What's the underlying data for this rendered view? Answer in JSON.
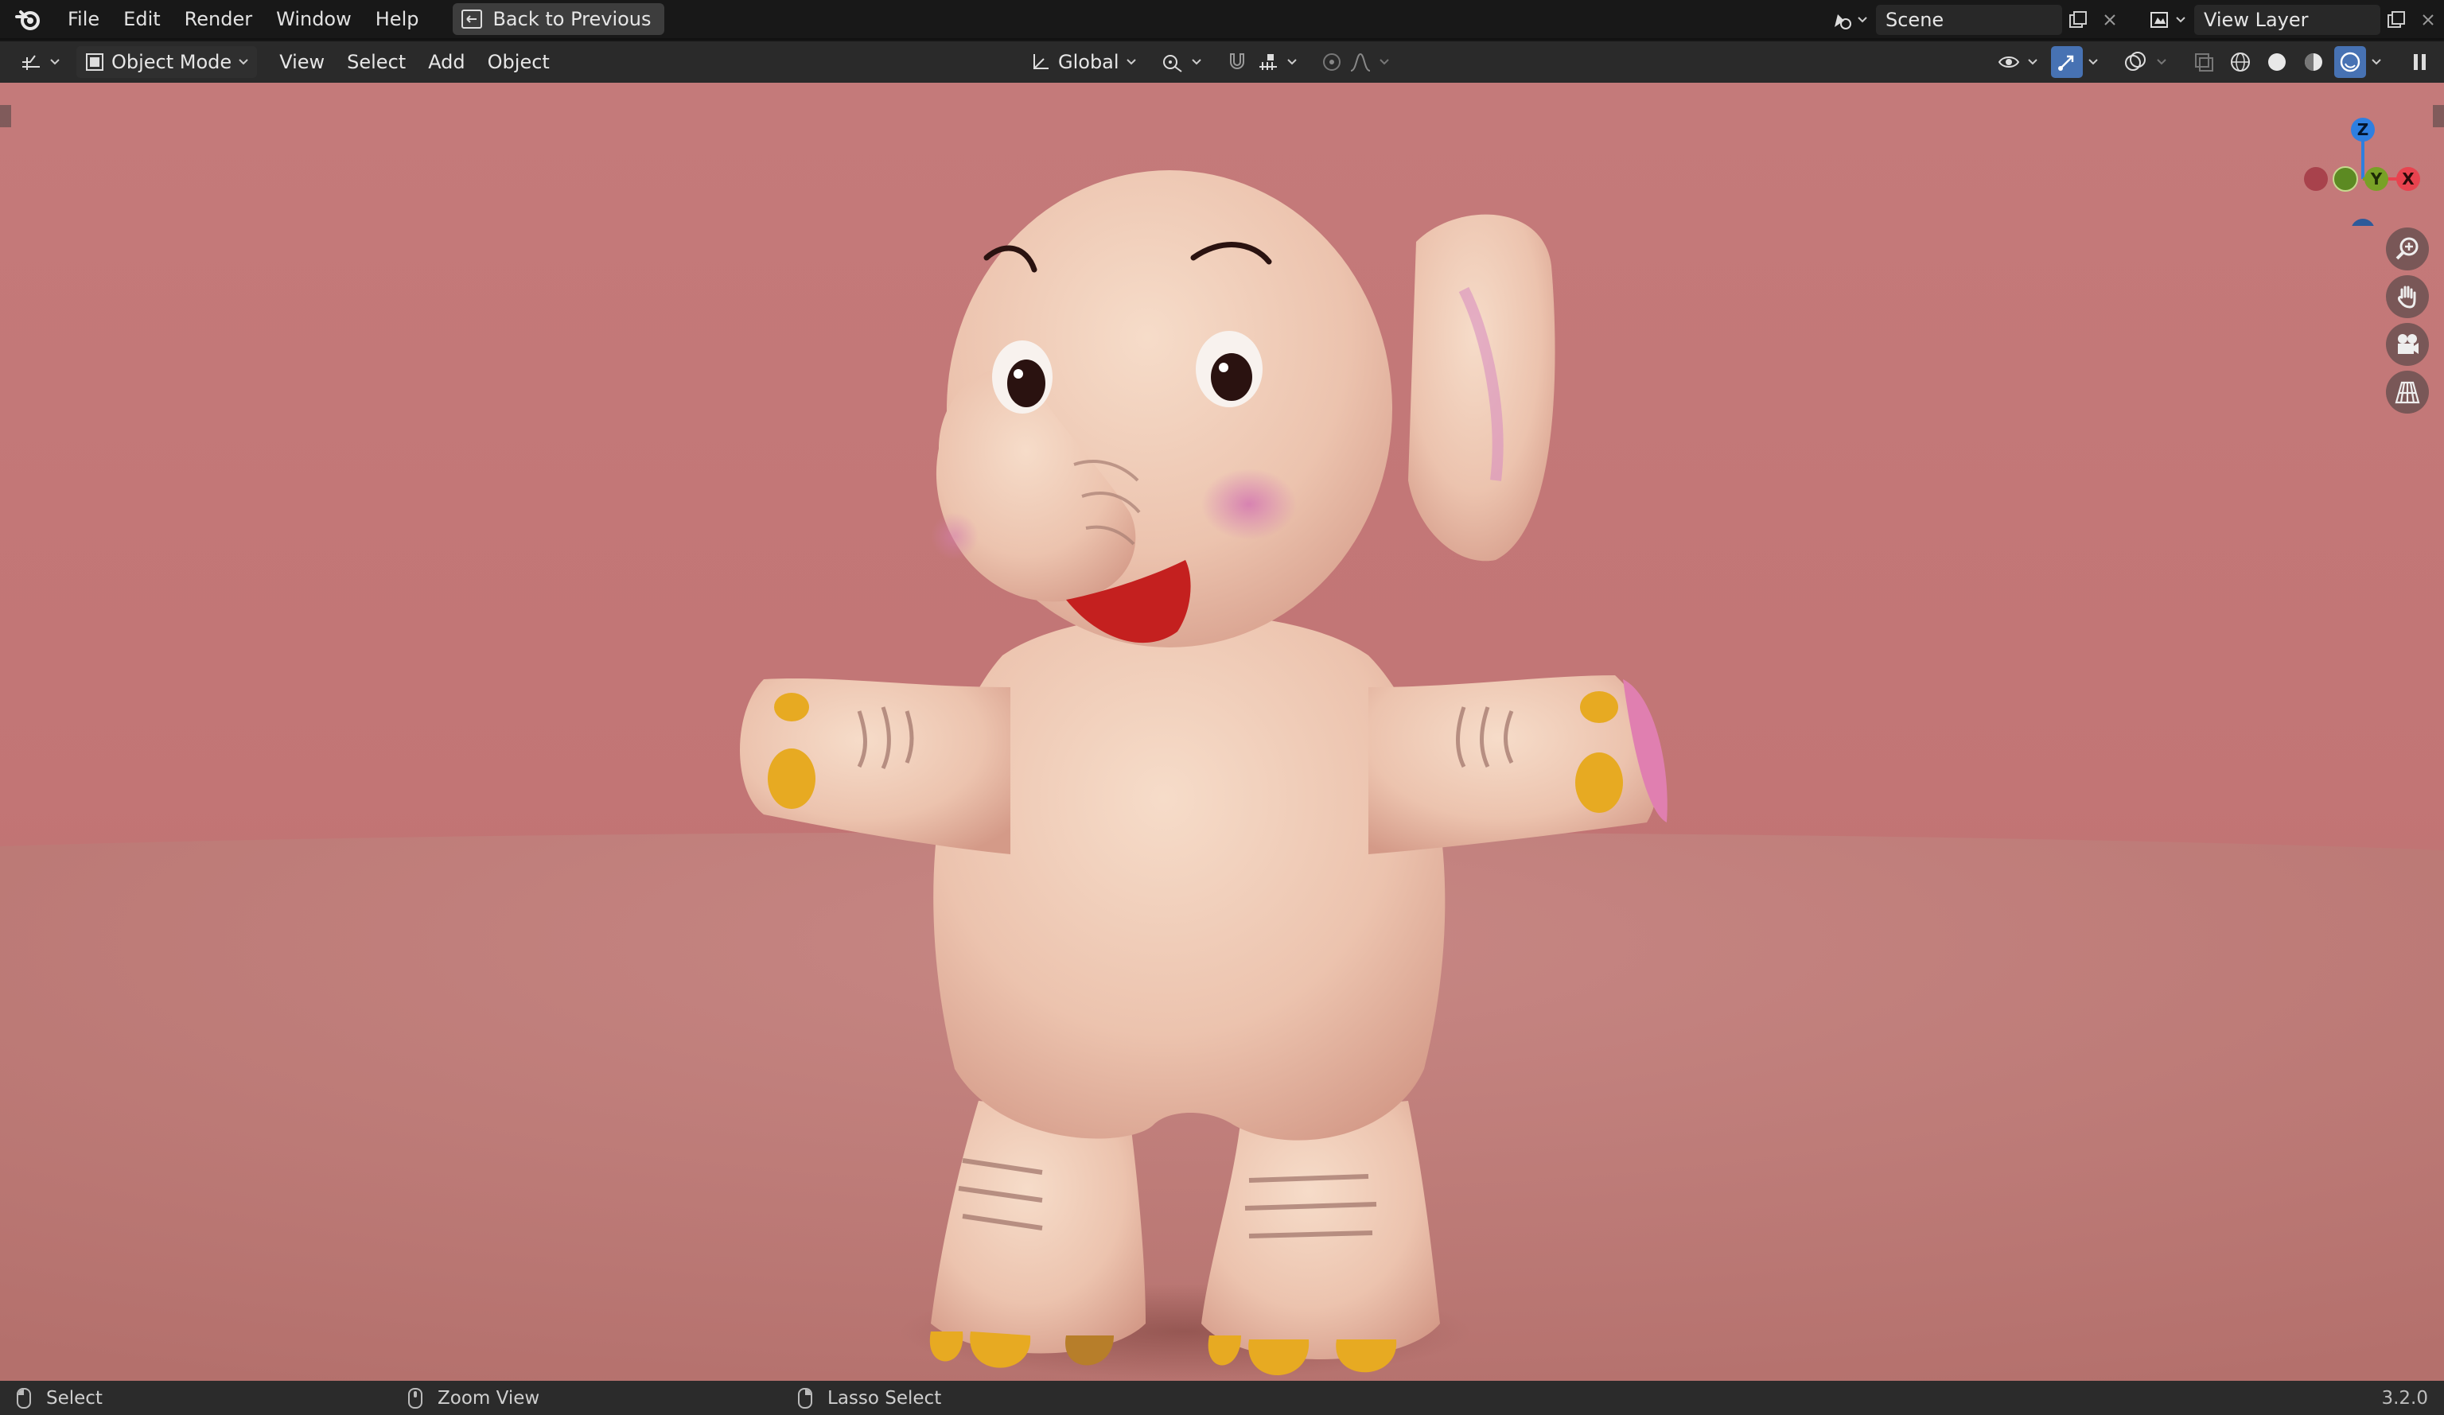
{
  "topbar": {
    "logo_icon": "blender-logo-icon",
    "menus": [
      "File",
      "Edit",
      "Render",
      "Window",
      "Help"
    ],
    "back_button": "Back to Previous",
    "scene": "Scene",
    "view_layer": "View Layer"
  },
  "header": {
    "editor_type_icon": "viewport-editor-icon",
    "mode": "Object Mode",
    "menus": [
      "View",
      "Select",
      "Add",
      "Object"
    ],
    "orientation": "Global",
    "pivot_icon": "pivot-icon",
    "snap_icon": "magnet-icon",
    "proportional_icon": "proportional-edit-icon",
    "shading_active": "rendered",
    "colors": {
      "active": "#4772b3"
    }
  },
  "gizmo": {
    "axes": {
      "x": "X",
      "y": "Y",
      "z": "Z"
    },
    "colors": {
      "x": "#e8434f",
      "y": "#78a126",
      "z": "#2f7fe0",
      "neg_x": "#a8424c",
      "neg_y": "#5c8a22",
      "neg_z": "#2d5a9a"
    }
  },
  "nav_buttons": [
    "zoom-icon",
    "hand-pan-icon",
    "camera-icon",
    "perspective-grid-icon"
  ],
  "viewport": {
    "background": "#c47a7a",
    "subject": "elephant-character"
  },
  "status": {
    "select": "Select",
    "zoom": "Zoom View",
    "lasso": "Lasso Select",
    "version": "3.2.0"
  }
}
